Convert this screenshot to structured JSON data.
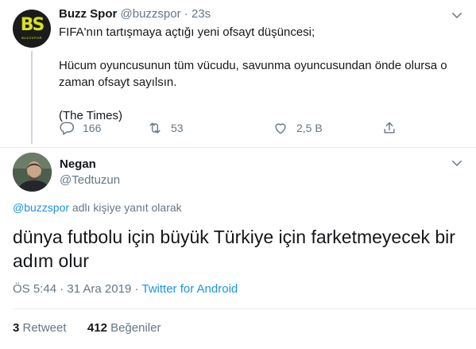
{
  "parent_tweet": {
    "avatar_text": "BS",
    "avatar_subtext": "BUZZSPOR",
    "name": "Buzz Spor",
    "handle": "@buzzspor",
    "separator": "·",
    "time": "23s",
    "text_lines": [
      "FIFA'nın tartışmaya açtığı yeni ofsayt düşüncesi;",
      "Hücum oyuncusunun tüm vücudu, savunma oyuncusundan önde olursa o",
      "zaman ofsayt sayılsın.",
      "(The Times)"
    ],
    "actions": {
      "reply_count": "166",
      "retweet_count": "53",
      "like_count": "2,5 B",
      "icons": [
        "reply-icon",
        "retweet-icon",
        "like-icon",
        "share-icon"
      ]
    }
  },
  "main_tweet": {
    "name": "Negan",
    "handle": "@Tedtuzun",
    "reply_to": {
      "mention": "@buzzspor",
      "suffix": " adlı kişiye yanıt olarak"
    },
    "text": "dünya futbolu için büyük Türkiye için farketmeyecek bir adım olur",
    "meta": {
      "time": "ÖS 5:44",
      "sep1": " · ",
      "date": "31 Ara 2019",
      "sep2": " · ",
      "source": "Twitter for Android"
    },
    "stats": {
      "retweets_count": "3",
      "retweets_label": " Retweet",
      "likes_count": "412",
      "likes_label": " Beğeniler"
    }
  },
  "colors": {
    "text": "#14171a",
    "secondary": "#657786",
    "link": "#1b95e0",
    "divider": "#e6ecf0",
    "logo_accent": "#d7e021"
  }
}
